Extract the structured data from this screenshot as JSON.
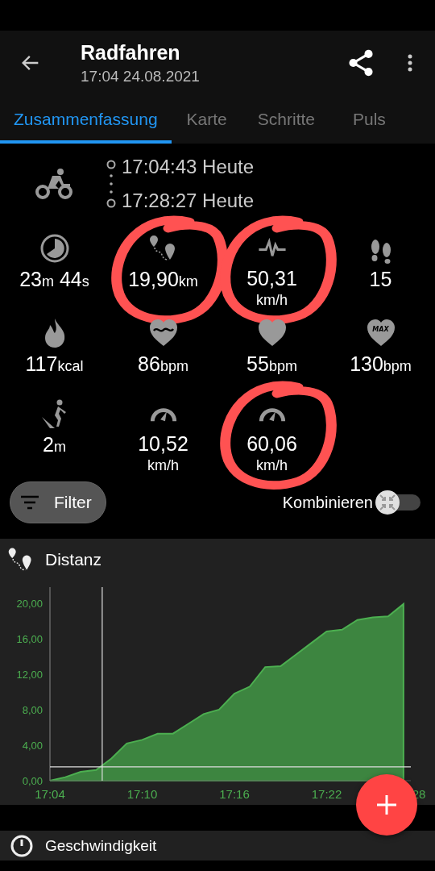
{
  "app_bar": {
    "title": "Radfahren",
    "subtitle": "17:04 24.08.2021"
  },
  "tabs": [
    {
      "label": "Zusammenfassung",
      "selected": true
    },
    {
      "label": "Karte",
      "selected": false
    },
    {
      "label": "Schritte",
      "selected": false
    },
    {
      "label": "Puls",
      "selected": false
    }
  ],
  "times": [
    "17:04:43 Heute",
    "17:28:27 Heute"
  ],
  "stats": [
    {
      "parts": [
        {
          "value": "23",
          "unit": "m"
        },
        {
          "value": " 44",
          "unit": "s"
        }
      ],
      "circled": false
    },
    {
      "parts": [
        {
          "value": "19,90",
          "unit": "km"
        }
      ],
      "circled": true
    },
    {
      "parts": [
        {
          "value": "50,31"
        }
      ],
      "unit_below": "km/h",
      "circled": true
    },
    {
      "parts": [
        {
          "value": "15"
        }
      ],
      "circled": false
    },
    {
      "parts": [
        {
          "value": "117",
          "unit": "kcal"
        }
      ],
      "circled": false
    },
    {
      "parts": [
        {
          "value": "86",
          "unit": "bpm"
        }
      ],
      "circled": false
    },
    {
      "parts": [
        {
          "value": "55",
          "unit": "bpm"
        }
      ],
      "circled": false
    },
    {
      "parts": [
        {
          "value": "130",
          "unit": "bpm"
        }
      ],
      "badge": "MAX",
      "circled": false
    },
    {
      "parts": [
        {
          "value": "2",
          "unit": "m"
        }
      ],
      "circled": false
    },
    {
      "parts": [
        {
          "value": "10,52"
        }
      ],
      "unit_below": "km/h",
      "circled": false
    },
    {
      "parts": [
        {
          "value": "60,06"
        }
      ],
      "unit_below": "km/h",
      "circled": true
    }
  ],
  "filter_button": {
    "label": "Filter"
  },
  "combine_toggle": {
    "label": "Kombinieren",
    "on": false
  },
  "distance_card": {
    "chart_data": {
      "type": "area",
      "title": "Distanz",
      "categories": [
        "17:04",
        null,
        null,
        null,
        null,
        null,
        "17:10",
        null,
        null,
        null,
        null,
        null,
        "17:16",
        null,
        null,
        null,
        null,
        null,
        "17:22",
        null,
        null,
        null,
        null,
        null,
        "28"
      ],
      "series": [
        {
          "color": "#4caf50",
          "values": [
            0,
            0.4,
            1.0,
            1.2,
            2.5,
            4.2,
            4.6,
            5.3,
            5.3,
            6.4,
            7.5,
            8.0,
            9.8,
            10.6,
            12.8,
            12.9,
            14.2,
            15.5,
            16.8,
            17.0,
            18.1,
            18.4,
            18.5,
            19.9,
            null
          ]
        }
      ],
      "ylim": [
        0,
        21.8
      ],
      "yticks": [
        {
          "value": 0,
          "label": "0,00"
        },
        {
          "value": 4,
          "label": "4,00"
        },
        {
          "value": 8,
          "label": "8,00"
        },
        {
          "value": 12,
          "label": "12,00"
        },
        {
          "value": 16,
          "label": "16,00"
        },
        {
          "value": 20,
          "label": "20,00"
        }
      ],
      "ref_lines": [
        {
          "axis": "y",
          "value": 1.55
        }
      ]
    }
  },
  "speed_card": {
    "title": "Geschwindigkeit"
  }
}
